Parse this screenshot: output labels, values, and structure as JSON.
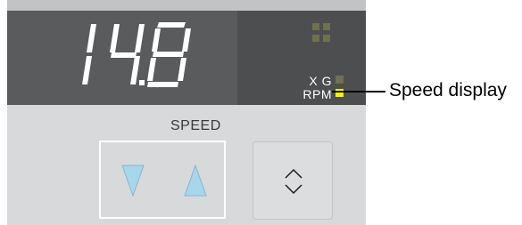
{
  "display": {
    "value": "14.8",
    "segment_color": "#ffffff",
    "background_color": "#5a5b5d"
  },
  "indicators": [
    {
      "label": "X G",
      "led_color": "#6f704f",
      "lit": false
    },
    {
      "label": "RPM",
      "led_color": "#ffee00",
      "lit": true
    }
  ],
  "controls": {
    "label": "SPEED",
    "down_icon": "triangle-down-icon",
    "up_icon": "triangle-up-icon",
    "toggle_icon": "up-down-chevron-icon",
    "arrow_color": "#a8d6ea"
  },
  "callout": {
    "text": "Speed display"
  }
}
